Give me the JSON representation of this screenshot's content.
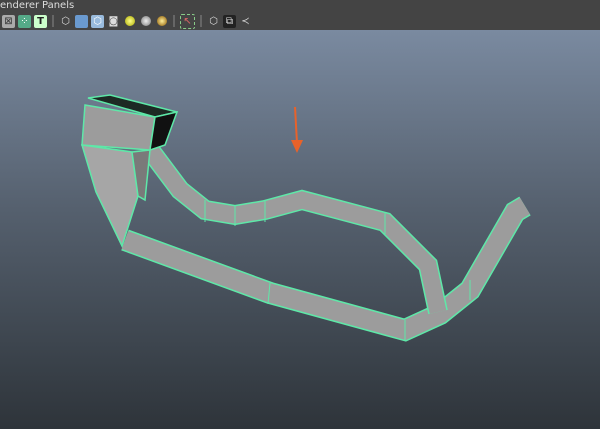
{
  "menu": {
    "items": [
      "enderer",
      "Panels"
    ]
  },
  "toolbar": {
    "icons": [
      "xray-icon",
      "grid-snap-icon",
      "texture-icon",
      "wireframe-cube-icon",
      "smooth-shade-cube-icon",
      "shaded-wireframe-cube-icon",
      "checker-icon",
      "light-default-icon",
      "light-all-icon",
      "light-gold-icon",
      "select-region-icon",
      "isolate-cube-icon",
      "duplicate-icon",
      "share-node-icon"
    ]
  },
  "viewport": {
    "model_edge_color": "#5ee8a8",
    "model_fill": "#9c9c9c",
    "arrow_color": "#e8622a"
  }
}
